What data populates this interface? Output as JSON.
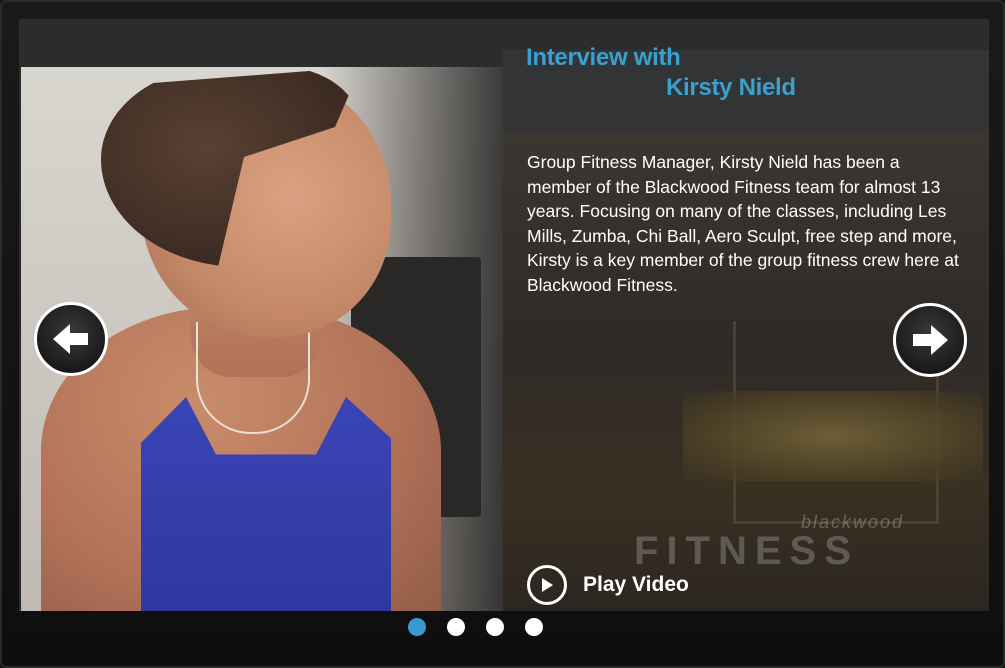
{
  "slide": {
    "title_line1": "Interview with",
    "title_line2": "Kirsty Nield",
    "description": "Group Fitness Manager, Kirsty Nield has been a member of the Blackwood Fitness team for almost 13 years. Focusing on many of the classes, including Les Mills, Zumba, Chi Ball, Aero Sculpt, free step and more, Kirsty is a key member of the group fitness crew here at Blackwood Fitness.",
    "play_label": "Play Video",
    "watermark_small": "blackwood",
    "watermark_big": "FITNESS"
  },
  "navigation": {
    "prev_icon": "arrow-left-icon",
    "next_icon": "arrow-right-icon"
  },
  "pagination": {
    "total": 4,
    "active_index": 0
  },
  "colors": {
    "title": "#3aa0d0",
    "active_dot": "#3a9ad0",
    "inactive_dot": "#ffffff"
  }
}
